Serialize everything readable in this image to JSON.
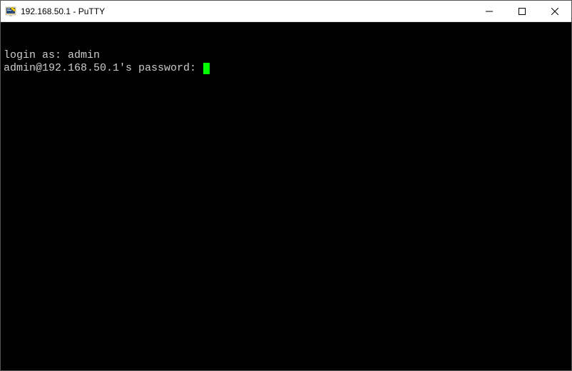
{
  "titlebar": {
    "title": "192.168.50.1 - PuTTY"
  },
  "terminal": {
    "line1": "login as: admin",
    "line2": "admin@192.168.50.1's password: "
  }
}
